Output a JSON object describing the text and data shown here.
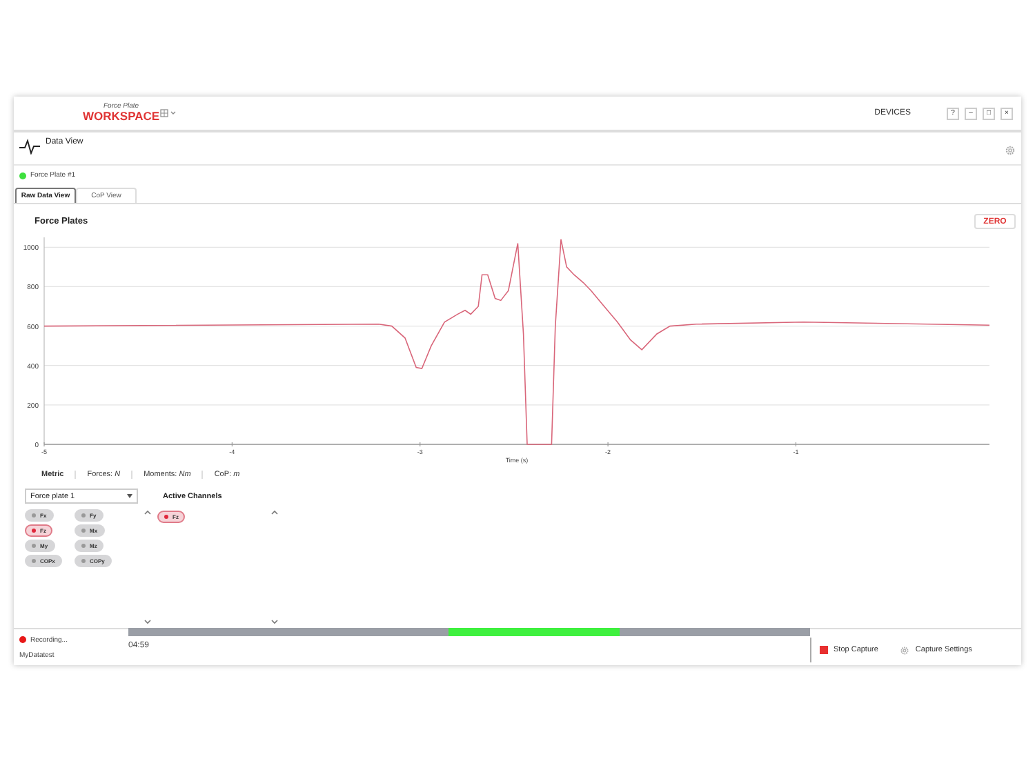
{
  "window": {
    "logo_small": "Force Plate",
    "logo": "WORKSPACE",
    "nav": "DEVICES",
    "controls": [
      "?",
      "–",
      "□",
      "×"
    ]
  },
  "view": {
    "title": "Data View"
  },
  "device": {
    "name": "Force Plate #1",
    "connected": true
  },
  "tabs": [
    {
      "label": "Raw Data View",
      "selected": true
    },
    {
      "label": "CoP View",
      "selected": false
    }
  ],
  "panel": {
    "title": "Force Plates",
    "zero_button": "ZERO"
  },
  "chart": {
    "chart_data": {
      "type": "line",
      "xlabel": "Time (s)",
      "xlim": [
        -5,
        0.03
      ],
      "ylim": [
        0,
        1050
      ],
      "grid": true,
      "xticks": [
        -5,
        -4,
        -3,
        -2,
        -1
      ],
      "yticks": [
        0,
        200,
        400,
        600,
        800,
        1000
      ],
      "x": [
        -5,
        -3.22,
        -3.15,
        -3.08,
        -3.02,
        -2.99,
        -2.94,
        -2.87,
        -2.8,
        -2.76,
        -2.73,
        -2.69,
        -2.67,
        -2.64,
        -2.6,
        -2.57,
        -2.53,
        -2.48,
        -2.45,
        -2.43,
        -2.3,
        -2.28,
        -2.25,
        -2.22,
        -2.18,
        -2.13,
        -2.09,
        -2.02,
        -1.95,
        -1.88,
        -1.82,
        -1.74,
        -1.67,
        -1.53,
        -0.96,
        0.03
      ],
      "series": [
        {
          "color": "#d9667a",
          "values": [
            600,
            610,
            600,
            540,
            390,
            385,
            500,
            620,
            660,
            680,
            660,
            700,
            860,
            860,
            740,
            730,
            780,
            1020,
            560,
            0,
            0,
            600,
            1040,
            900,
            860,
            820,
            780,
            700,
            620,
            530,
            480,
            560,
            600,
            610,
            620,
            605
          ]
        }
      ]
    }
  },
  "units": [
    {
      "label": "Metric",
      "kind": "heading"
    },
    {
      "label": "Forces: *N*",
      "kind": "unit"
    },
    {
      "label": "Moments: *Nm*",
      "kind": "unit"
    },
    {
      "label": "CoP: *m*",
      "kind": "unit"
    }
  ],
  "plate_select": {
    "value": "Force plate 1"
  },
  "channels": [
    {
      "label": "Fx",
      "selected": false
    },
    {
      "label": "Fy",
      "selected": false
    },
    {
      "label": "Fz",
      "selected": true
    },
    {
      "label": "Mx",
      "selected": false
    },
    {
      "label": "My",
      "selected": false
    },
    {
      "label": "Mz",
      "selected": false
    },
    {
      "label": "COPx",
      "selected": false
    },
    {
      "label": "COPy",
      "selected": false
    }
  ],
  "active_channels": {
    "title": "Active Channels",
    "items": [
      {
        "label": "Fz",
        "selected": true
      }
    ]
  },
  "status_bar": {
    "recording": "Recording...",
    "dataset": "MyDatatest",
    "time": "04:59",
    "stop": "Stop Capture",
    "settings": "Capture Settings"
  }
}
